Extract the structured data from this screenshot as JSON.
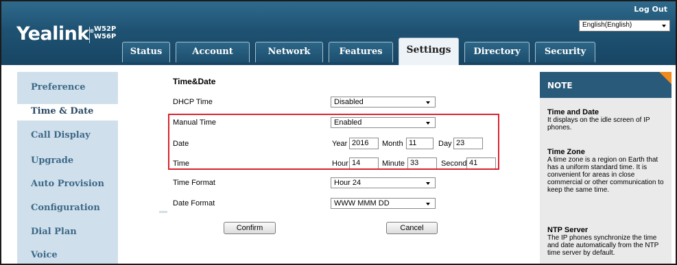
{
  "header": {
    "brand": "Yealink",
    "models": [
      "W52P",
      "W56P"
    ],
    "logout_label": "Log Out",
    "language": "English(English)"
  },
  "tabs": [
    {
      "label": "Status",
      "active": false
    },
    {
      "label": "Account",
      "active": false
    },
    {
      "label": "Network",
      "active": false
    },
    {
      "label": "Features",
      "active": false
    },
    {
      "label": "Settings",
      "active": true
    },
    {
      "label": "Directory",
      "active": false
    },
    {
      "label": "Security",
      "active": false
    }
  ],
  "sidebar": {
    "items": [
      {
        "label": "Preference",
        "active": false
      },
      {
        "label": "Time & Date",
        "active": true
      },
      {
        "label": "Call Display",
        "active": false
      },
      {
        "label": "Upgrade",
        "active": false
      },
      {
        "label": "Auto Provision",
        "active": false
      },
      {
        "label": "Configuration",
        "active": false
      },
      {
        "label": "Dial Plan",
        "active": false
      },
      {
        "label": "Voice",
        "active": false
      }
    ]
  },
  "form": {
    "section_title": "Time&Date",
    "dhcp_time": {
      "label": "DHCP Time",
      "value": "Disabled"
    },
    "manual_time": {
      "label": "Manual Time",
      "value": "Enabled"
    },
    "date": {
      "label": "Date",
      "year_label": "Year",
      "year": "2016",
      "month_label": "Month",
      "month": "11",
      "day_label": "Day",
      "day": "23"
    },
    "time": {
      "label": "Time",
      "hour_label": "Hour",
      "hour": "14",
      "minute_label": "Minute",
      "minute": "33",
      "second_label": "Second",
      "second": "41"
    },
    "time_format": {
      "label": "Time Format",
      "value": "Hour 24"
    },
    "date_format": {
      "label": "Date Format",
      "value": "WWW MMM DD"
    },
    "confirm_label": "Confirm",
    "cancel_label": "Cancel"
  },
  "note": {
    "header": "NOTE",
    "sections": [
      {
        "title": "Time and Date",
        "text": "It displays on the idle screen of IP phones."
      },
      {
        "title": "Time Zone",
        "text": "A time zone is a region on Earth that has a uniform standard time. It is convenient for areas in close commercial or other communication to keep the same time."
      },
      {
        "title": "NTP Server",
        "text": "The IP phones synchronize the time and date automatically from the NTP time server by default."
      }
    ]
  },
  "colors": {
    "header_blue": "#1f5272",
    "nav_bg": "#cfe0ec",
    "nav_text": "#3e6887",
    "highlight_red": "#d8212b",
    "note_accent": "#f08a1c"
  }
}
